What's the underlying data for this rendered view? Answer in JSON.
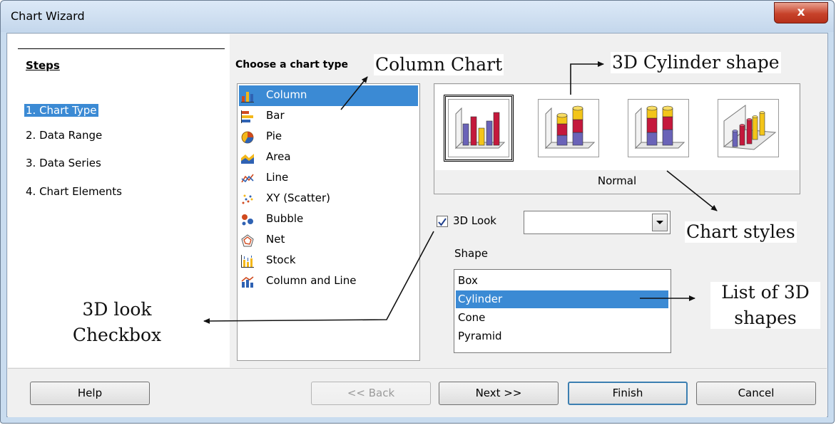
{
  "window": {
    "title": "Chart Wizard",
    "close_label": "x"
  },
  "steps": {
    "title": "Steps",
    "items": [
      "1. Chart Type",
      "2. Data Range",
      "3. Data Series",
      "4. Chart Elements"
    ],
    "selected_index": 0
  },
  "chart_type": {
    "heading": "Choose a chart type",
    "items": [
      {
        "label": "Column",
        "icon": "column-chart-icon"
      },
      {
        "label": "Bar",
        "icon": "bar-chart-icon"
      },
      {
        "label": "Pie",
        "icon": "pie-chart-icon"
      },
      {
        "label": "Area",
        "icon": "area-chart-icon"
      },
      {
        "label": "Line",
        "icon": "line-chart-icon"
      },
      {
        "label": "XY (Scatter)",
        "icon": "scatter-chart-icon"
      },
      {
        "label": "Bubble",
        "icon": "bubble-chart-icon"
      },
      {
        "label": "Net",
        "icon": "net-chart-icon"
      },
      {
        "label": "Stock",
        "icon": "stock-chart-icon"
      },
      {
        "label": "Column and Line",
        "icon": "column-line-chart-icon"
      }
    ],
    "selected": "Column"
  },
  "styles": {
    "variant_label": "Normal",
    "thumbnails": [
      "normal-3d-column-icon",
      "stacked-3d-column-icon",
      "percent-stacked-3d-column-icon",
      "deep-3d-column-icon"
    ],
    "selected_index": 0
  },
  "look3d": {
    "label": "3D Look",
    "checked": true,
    "combo_value": ""
  },
  "shape": {
    "label": "Shape",
    "items": [
      "Box",
      "Cylinder",
      "Cone",
      "Pyramid"
    ],
    "selected": "Cylinder"
  },
  "buttons": {
    "help": "Help",
    "back": "<< Back",
    "next": "Next >>",
    "finish": "Finish",
    "cancel": "Cancel"
  },
  "annotations": {
    "column_chart": "Column Chart",
    "cylinder_shape": "3D Cylinder shape",
    "chart_styles": "Chart styles",
    "list_3d_line1": "List of 3D",
    "list_3d_line2": "shapes",
    "look3d_line1": "3D look",
    "look3d_line2": "Checkbox"
  },
  "colors": {
    "selection": "#3b8ad4",
    "window_frame": "#c9dcef",
    "close_button": "#c7422a"
  }
}
